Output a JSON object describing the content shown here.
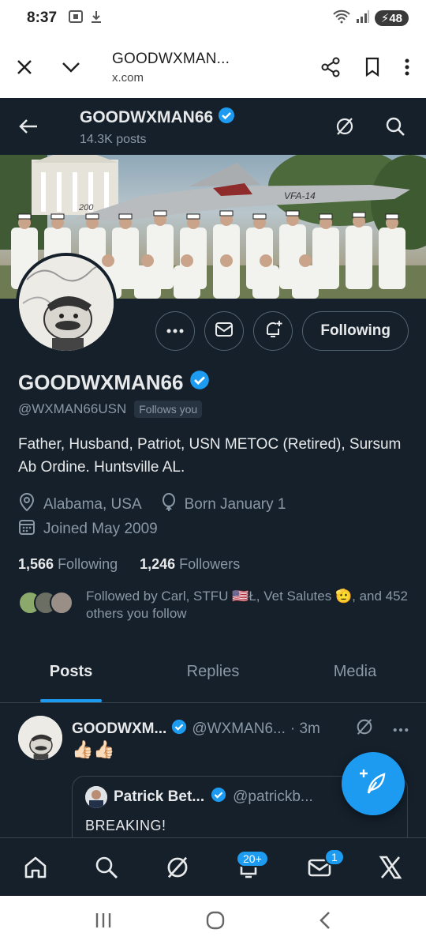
{
  "status_bar": {
    "time": "8:37",
    "battery": "48"
  },
  "browser": {
    "page_title": "GOODWXMAN...",
    "url": "x.com"
  },
  "header": {
    "name": "GOODWXMAN66",
    "posts": "14.3K posts"
  },
  "profile": {
    "name": "GOODWXMAN66",
    "handle": "@WXMAN66USN",
    "follows_you": "Follows you",
    "bio": "Father, Husband, Patriot, USN METOC (Retired), Sursum Ab Ordine. Huntsville AL.",
    "location": "Alabama, USA",
    "born": "Born January 1",
    "joined": "Joined May 2009",
    "following_count": "1,566",
    "following_label": "Following",
    "followers_count": "1,246",
    "followers_label": "Followers",
    "followed_by": "Followed by Carl, STFU 🇺🇸Ł, Vet Salutes 🫡, and 452 others you follow",
    "follow_button": "Following"
  },
  "banner": {
    "jet_label": "VFA-14",
    "jet_number": "200"
  },
  "tabs": [
    {
      "label": "Posts",
      "active": true
    },
    {
      "label": "Replies",
      "active": false
    },
    {
      "label": "Media",
      "active": false
    }
  ],
  "post": {
    "author": "GOODWXM...",
    "handle": "@WXMAN6...",
    "time": "· 3m",
    "text": "👍🏻👍🏻",
    "quote": {
      "author": "Patrick Bet...",
      "handle": "@patrickb...",
      "text": "BREAKING!"
    }
  },
  "bottom_nav": {
    "notifications_badge": "20+",
    "messages_badge": "1"
  },
  "colors": {
    "accent": "#1d9bf0",
    "background": "#15202b",
    "secondary_text": "#8b98a5"
  }
}
